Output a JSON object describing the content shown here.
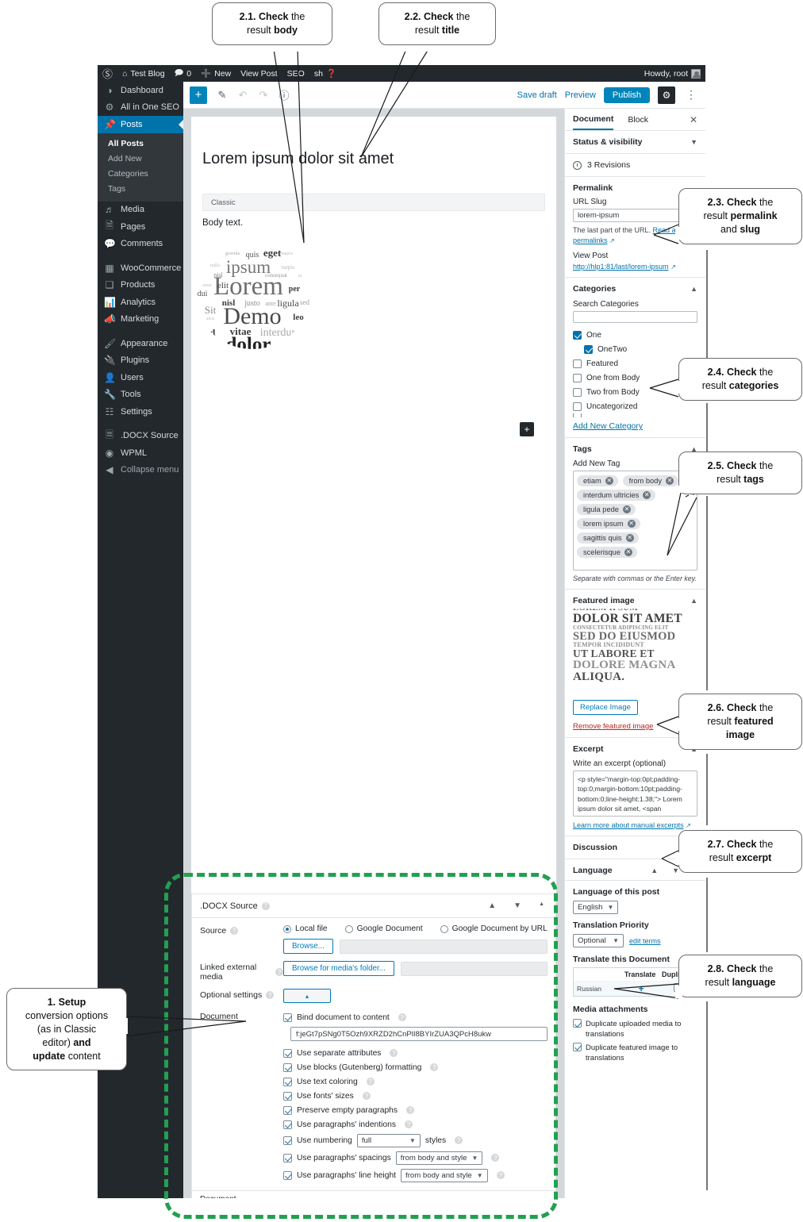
{
  "adminbar": {
    "site_name": "Test Blog",
    "comments_count": "0",
    "new_label": "New",
    "view_post": "View Post",
    "seo": "SEO",
    "partial_item": "sh",
    "howdy": "Howdy, root"
  },
  "sidebar": {
    "items": [
      {
        "label": "Dashboard",
        "icon": "dashboard-icon"
      },
      {
        "label": "All in One SEO",
        "icon": "gear-icon"
      },
      {
        "label": "Posts",
        "icon": "pin-icon",
        "current": true
      },
      {
        "label": "Media",
        "icon": "media-icon"
      },
      {
        "label": "Pages",
        "icon": "pages-icon"
      },
      {
        "label": "Comments",
        "icon": "comment-icon"
      },
      {
        "label": "WooCommerce",
        "icon": "woocommerce-icon"
      },
      {
        "label": "Products",
        "icon": "products-icon"
      },
      {
        "label": "Analytics",
        "icon": "analytics-icon"
      },
      {
        "label": "Marketing",
        "icon": "megaphone-icon"
      },
      {
        "label": "Appearance",
        "icon": "brush-icon"
      },
      {
        "label": "Plugins",
        "icon": "plug-icon"
      },
      {
        "label": "Users",
        "icon": "user-icon"
      },
      {
        "label": "Tools",
        "icon": "wrench-icon"
      },
      {
        "label": "Settings",
        "icon": "settings-icon"
      },
      {
        "label": ".DOCX Source",
        "icon": "docx-icon"
      },
      {
        "label": "WPML",
        "icon": "wpml-icon"
      },
      {
        "label": "Collapse menu",
        "icon": "collapse-icon"
      }
    ],
    "submenu": [
      {
        "label": "All Posts",
        "active": true
      },
      {
        "label": "Add New",
        "active": false
      },
      {
        "label": "Categories",
        "active": false
      },
      {
        "label": "Tags",
        "active": false
      }
    ]
  },
  "editor_header": {
    "add_block": "+",
    "save_draft": "Save draft",
    "preview": "Preview",
    "publish": "Publish",
    "settings_icon": "gear-icon",
    "more_icon": "ellipsis-icon"
  },
  "canvas": {
    "post_title": "Lorem ipsum dolor sit amet",
    "classic_block_label": "Classic",
    "body_text": "Body text.",
    "block_inserter": "+",
    "wordcloud_words": [
      "Lorem",
      "Demo",
      "dolor",
      "ipsum",
      "non",
      "sed",
      "vitae",
      "interdum",
      "eget",
      "quis",
      "nisl",
      "justo",
      "ante",
      "ligula",
      "per",
      "elit",
      "dui",
      "Sit",
      "leo",
      "orci",
      "nunc",
      "porta",
      "arcu",
      "urna",
      "risus",
      "sed",
      "consequat",
      "gravida"
    ]
  },
  "inspector": {
    "tabs": [
      {
        "label": "Document",
        "active": true
      },
      {
        "label": "Block",
        "active": false
      }
    ],
    "close_icon": "close-icon",
    "status_visibility": "Status & visibility",
    "revisions": "3 Revisions",
    "permalink": {
      "title": "Permalink",
      "url_slug_label": "URL Slug",
      "slug_value": "lorem-ipsum",
      "helper_prefix": "The last part of the URL. ",
      "helper_link": "Read about permalinks",
      "view_post_label": "View Post",
      "view_post_url": "http://hlp1:81/last/lorem-ipsum"
    },
    "categories": {
      "title": "Categories",
      "search_label": "Search Categories",
      "items": [
        {
          "label": "One",
          "checked": true,
          "indent": false
        },
        {
          "label": "OneTwo",
          "checked": true,
          "indent": true
        },
        {
          "label": "Featured",
          "checked": false,
          "indent": false
        },
        {
          "label": "One from Body",
          "checked": false,
          "indent": false
        },
        {
          "label": "Two from Body",
          "checked": false,
          "indent": false
        },
        {
          "label": "Uncategorized",
          "checked": false,
          "indent": false
        }
      ],
      "add_new": "Add New Category"
    },
    "tags": {
      "title": "Tags",
      "add_label": "Add New Tag",
      "chips": [
        "etiam",
        "from body",
        "interdum ultricies",
        "ligula pede",
        "lorem ipsum",
        "sagittis quis",
        "scelerisque"
      ],
      "note": "Separate with commas or the Enter key."
    },
    "featured_image": {
      "title": "Featured image",
      "preview_lines": [
        "LOREM IPSUM",
        "DOLOR SIT AMET",
        "CONSECTETUR ADIPISCING ELIT",
        "SED DO EIUSMOD",
        "TEMPOR INCIDIDUNT",
        "UT LABORE ET",
        "DOLORE MAGNA",
        "ALIQUA."
      ],
      "replace_button": "Replace Image",
      "remove_link": "Remove featured image"
    },
    "excerpt": {
      "title": "Excerpt",
      "label": "Write an excerpt (optional)",
      "value": "<p style=\"margin-top:0pt;padding-top:0;margin-bottom:10pt;padding-bottom:0;line-height:1.38;\">\n   Lorem ipsum dolor sit amet, <span",
      "learn_more": "Learn more about manual excerpts"
    },
    "discussion": "Discussion",
    "language": {
      "title": "Language",
      "of_post_label": "Language of this post",
      "of_post_value": "English",
      "priority_label": "Translation Priority",
      "priority_value": "Optional",
      "edit_terms": "edit terms",
      "translate_doc_label": "Translate this Document",
      "table_headers": [
        "",
        "Translate",
        "Duplicate"
      ],
      "table_rows": [
        {
          "language": "Russian",
          "translate": "+",
          "duplicate": false
        }
      ],
      "media_attachments_label": "Media attachments",
      "media_options": [
        {
          "label": "Duplicate uploaded media to translations",
          "checked": true
        },
        {
          "label": "Duplicate featured image to translations",
          "checked": true
        }
      ]
    }
  },
  "docx_panel": {
    "title": ".DOCX Source",
    "help_icon": "help-icon",
    "controls": [
      "chevron-up-icon",
      "chevron-down-icon",
      "caret-up-icon"
    ],
    "source_label": "Source",
    "source_options": [
      {
        "label": "Local file",
        "selected": true
      },
      {
        "label": "Google Document",
        "selected": false
      },
      {
        "label": "Google Document by URL",
        "selected": false
      }
    ],
    "browse_button": "Browse...",
    "browse_value": "",
    "linked_media_label": "Linked external media",
    "linked_media_button": "Browse for media's folder...",
    "linked_media_value": "",
    "optional_settings_label": "Optional settings",
    "optional_settings_toggle": "▴",
    "document_label": "Document",
    "bind_label": "Bind document to content",
    "bind_checked": true,
    "document_token": "f:jeGt7pSNg0T5Ozh9XRZD2hCnPlI8BYIrZUA3QPcH8ukw",
    "options": [
      {
        "label": "Use separate attributes",
        "checked": true
      },
      {
        "label": "Use blocks (Gutenberg) formatting",
        "checked": true
      },
      {
        "label": "Use text coloring",
        "checked": true
      },
      {
        "label": "Use fonts' sizes",
        "checked": true
      },
      {
        "label": "Preserve empty paragraphs",
        "checked": true
      },
      {
        "label": "Use paragraphs' indentions",
        "checked": true
      }
    ],
    "numbering": {
      "prefix": "Use numbering",
      "value": "full",
      "suffix": "styles",
      "checked": true
    },
    "spacings": {
      "prefix": "Use paragraphs' spacings",
      "value": "from body and style",
      "checked": true
    },
    "lineheight": {
      "prefix": "Use paragraphs' line height",
      "value": "from body and style",
      "checked": true
    },
    "footer": "Document"
  },
  "callouts": [
    {
      "id": "c21",
      "html": "<b>2.1. Check</b> the<br>result <b>body</b>"
    },
    {
      "id": "c22",
      "html": "<b>2.2. Check</b> the<br>result <b>title</b>"
    },
    {
      "id": "c23",
      "html": "<b>2.3. Check</b> the<br>result <b>permalink</b><br>and <b>slug</b>"
    },
    {
      "id": "c24",
      "html": "<b>2.4. Check</b> the<br>result <b>categories</b>"
    },
    {
      "id": "c25",
      "html": "<b>2.5. Check</b> the<br>result <b>tags</b>"
    },
    {
      "id": "c26",
      "html": "<b>2.6. Check</b> the<br>result <b>featured</b><br><b>image</b>"
    },
    {
      "id": "c27",
      "html": "<b>2.7. Check</b> the<br>result <b>excerpt</b>"
    },
    {
      "id": "c28",
      "html": "<b>2.8. Check</b> the<br>result <b>language</b>"
    },
    {
      "id": "c1",
      "html": "<b>1. Setup</b><br>conversion options<br>(as in Classic<br>editor) <b>and</b><br><b>update</b> content"
    }
  ],
  "colors": {
    "wp_blue": "#0073aa",
    "publish_blue": "#0085ba",
    "admin_dark": "#23282d",
    "highlight_green": "#22a050",
    "link_red": "#b52727"
  }
}
